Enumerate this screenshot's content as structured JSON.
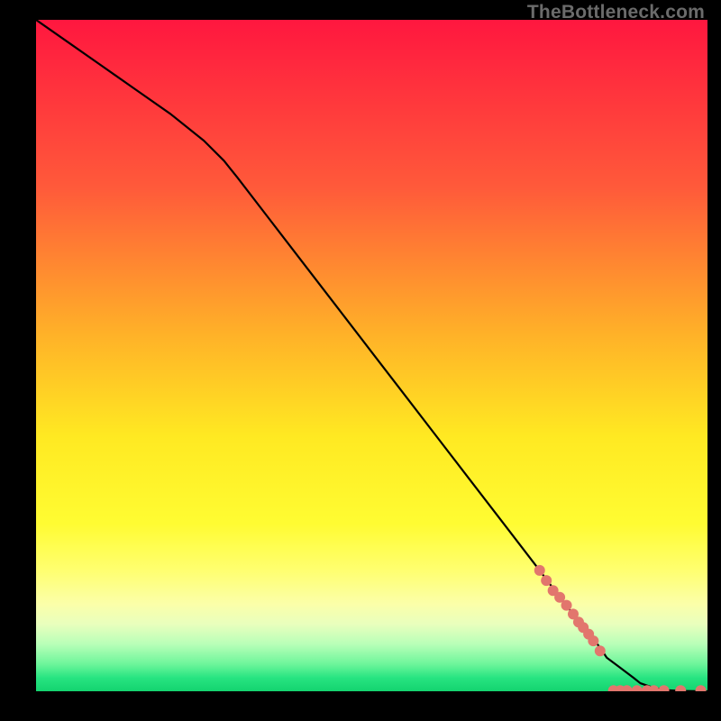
{
  "attribution": "TheBottleneck.com",
  "colors": {
    "line": "#000000",
    "marker": "#e2766d",
    "gradient_top": "#ff173f",
    "gradient_bottom": "#14d36f"
  },
  "chart_data": {
    "type": "line",
    "title": "",
    "xlabel": "",
    "ylabel": "",
    "xlim": [
      0,
      100
    ],
    "ylim": [
      0,
      100
    ],
    "grid": false,
    "legend": false,
    "series": [
      {
        "name": "curve",
        "x": [
          0,
          5,
          10,
          15,
          20,
          25,
          28,
          30,
          35,
          40,
          45,
          50,
          55,
          60,
          65,
          70,
          75,
          78,
          80,
          82,
          84,
          85,
          87,
          89,
          90,
          92,
          94,
          96,
          98,
          100
        ],
        "y": [
          100,
          96.5,
          93,
          89.5,
          86,
          82,
          79,
          76.5,
          70,
          63.5,
          57,
          50.5,
          44,
          37.5,
          31,
          24.5,
          18,
          14,
          11.5,
          9,
          6.5,
          5,
          3.5,
          2,
          1.2,
          0.5,
          0.15,
          0.05,
          0.02,
          0
        ]
      }
    ],
    "markers": [
      {
        "x": 75,
        "y": 18
      },
      {
        "x": 76,
        "y": 16.5
      },
      {
        "x": 77,
        "y": 15
      },
      {
        "x": 78,
        "y": 14
      },
      {
        "x": 79,
        "y": 12.8
      },
      {
        "x": 80,
        "y": 11.5
      },
      {
        "x": 80.8,
        "y": 10.3
      },
      {
        "x": 81.5,
        "y": 9.5
      },
      {
        "x": 82.3,
        "y": 8.5
      },
      {
        "x": 83,
        "y": 7.5
      },
      {
        "x": 84,
        "y": 6
      },
      {
        "x": 86,
        "y": 0.1
      },
      {
        "x": 87,
        "y": 0.1
      },
      {
        "x": 88,
        "y": 0.1
      },
      {
        "x": 89.5,
        "y": 0.1
      },
      {
        "x": 91,
        "y": 0.1
      },
      {
        "x": 92,
        "y": 0.1
      },
      {
        "x": 93.5,
        "y": 0.1
      },
      {
        "x": 96,
        "y": 0.1
      },
      {
        "x": 99,
        "y": 0.1
      }
    ]
  }
}
